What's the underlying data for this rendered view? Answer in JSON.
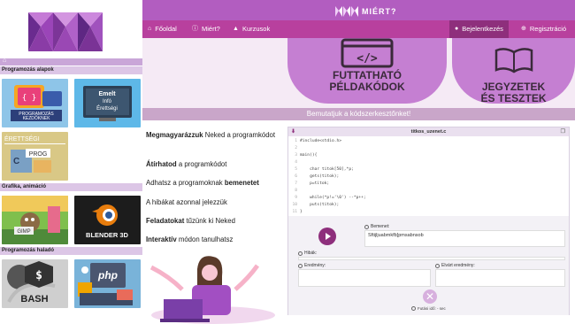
{
  "brand": {
    "name": "MIÉRT?"
  },
  "nav": {
    "home": "Főoldal",
    "why": "Miért?",
    "courses": "Kurzusok",
    "login": "Bejelentkezés",
    "register": "Regisztráció"
  },
  "sidebar": {
    "sections": [
      {
        "title": "Programozás alapok"
      },
      {
        "title": "Grafika, animáció"
      },
      {
        "title": "Programozás haladó"
      }
    ],
    "tiles": {
      "prog": "PROGRAMOZÁS KEZDŐKNEK",
      "emelt": [
        "Emelt",
        "Infó",
        "Érettségi"
      ],
      "erettsegi": [
        "ÉRETTSÉGI",
        "PROG"
      ],
      "gimp": "GIMP",
      "blender": "BLENDER 3D",
      "bash": "BASH",
      "php": "php"
    }
  },
  "hero": {
    "card1": [
      "FUTTATHATÓ",
      "PÉLDAKÓDOK"
    ],
    "card2": [
      "JEGYZETEK",
      "ÉS TESZTEK"
    ]
  },
  "banner": "Bemutatjuk a kódszerkesztőnket!",
  "features": [
    {
      "bold": "Megmagyarázzuk",
      "rest": " Neked a programkódot"
    },
    {
      "bold": "Átírhatod",
      "rest": " a programkódot"
    },
    {
      "pre": "Adhatsz a programoknak ",
      "bold": "bemenetet"
    },
    {
      "pre": "A hibákat azonnal jelezzük"
    },
    {
      "bold": "Feladatokat",
      "rest": " tűzünk ki Neked"
    },
    {
      "bold": "Interaktív",
      "rest": " módon tanulhatsz"
    }
  ],
  "editor": {
    "filename": "titkos_uzenet.c",
    "code": [
      "#include<stdio.h>",
      "",
      "main(){",
      "",
      "    char titok[50],*p;",
      "    gets(titok);",
      "    p=titok;",
      "",
      "    while(*p!='\\0') --*p++;",
      "    puts(titok);",
      "}"
    ],
    "input_label": "Bemenet:",
    "input_value": "Sftijljuabmkfb]pmsabnsob",
    "errors_label": "Hibák:",
    "result_label": "Eredmény:",
    "expected_label": "Elvárt eredmény:",
    "runtime_label": "Futási idő: - sec"
  },
  "colors": {
    "header": "#b25dc0",
    "nav": "#b8409e",
    "accent": "#8e2f7c"
  }
}
